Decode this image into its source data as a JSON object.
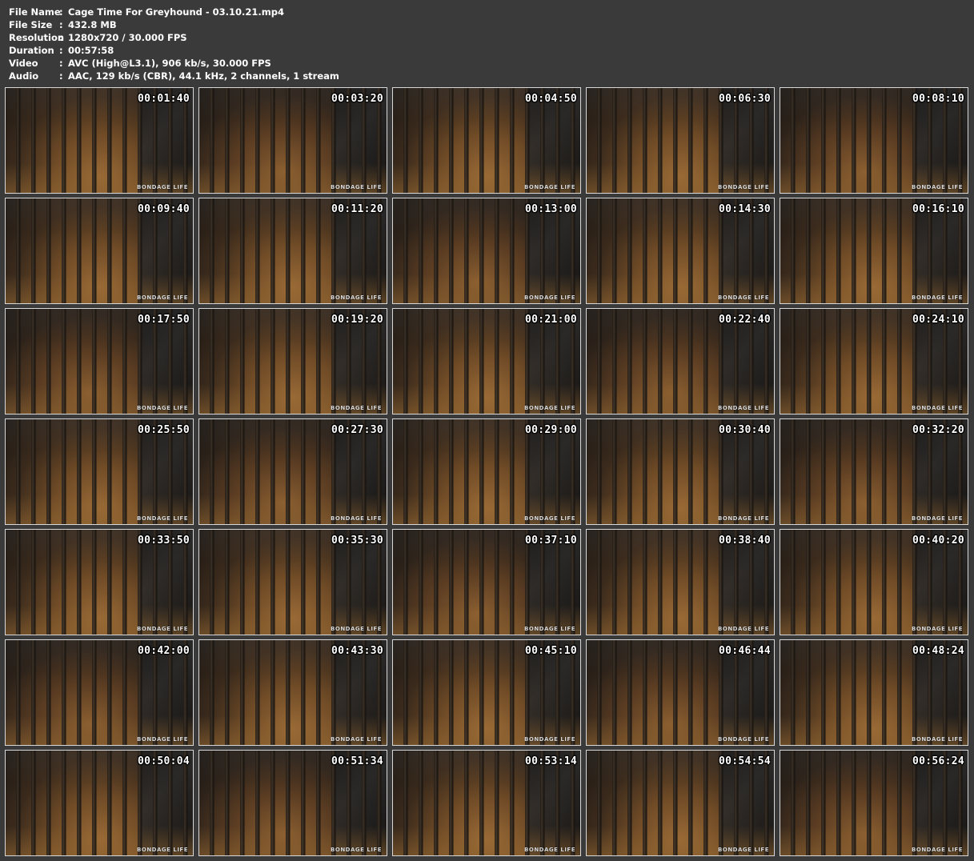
{
  "info": [
    {
      "key": "File Name",
      "sep": ":",
      "value": "Cage Time For Greyhound - 03.10.21.mp4"
    },
    {
      "key": "File Size",
      "sep": ":",
      "value": "432.8 MB"
    },
    {
      "key": "Resolution",
      "sep": ":",
      "value": "1280x720 / 30.000 FPS"
    },
    {
      "key": "Duration",
      "sep": ":",
      "value": "00:57:58"
    },
    {
      "key": "Video",
      "sep": ":",
      "value": "AVC (High@L3.1), 906 kb/s, 30.000 FPS"
    },
    {
      "key": "Audio",
      "sep": ":",
      "value": "AAC, 129 kb/s (CBR), 44.1 kHz, 2 channels, 1 stream"
    }
  ],
  "logo_text": "BONDAGE LIFE",
  "thumbnails": [
    "00:01:40",
    "00:03:20",
    "00:04:50",
    "00:06:30",
    "00:08:10",
    "00:09:40",
    "00:11:20",
    "00:13:00",
    "00:14:30",
    "00:16:10",
    "00:17:50",
    "00:19:20",
    "00:21:00",
    "00:22:40",
    "00:24:10",
    "00:25:50",
    "00:27:30",
    "00:29:00",
    "00:30:40",
    "00:32:20",
    "00:33:50",
    "00:35:30",
    "00:37:10",
    "00:38:40",
    "00:40:20",
    "00:42:00",
    "00:43:30",
    "00:45:10",
    "00:46:44",
    "00:48:24",
    "00:50:04",
    "00:51:34",
    "00:53:14",
    "00:54:54",
    "00:56:24"
  ]
}
